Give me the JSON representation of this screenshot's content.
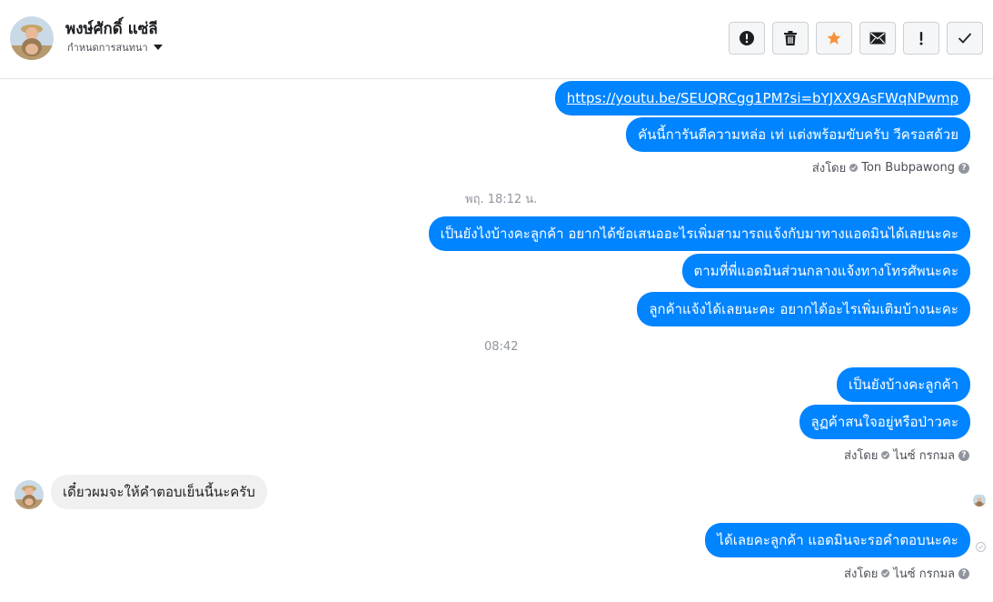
{
  "header": {
    "name": "พงษ์ศักดิ์ แซ่ลี",
    "assign_label": "กำหนดการสนทนา",
    "toolbar": [
      {
        "name": "report-spam-button",
        "icon": "alert-circle-icon"
      },
      {
        "name": "delete-button",
        "icon": "trash-icon"
      },
      {
        "name": "star-button",
        "icon": "star-icon",
        "color": "#f7923b"
      },
      {
        "name": "mark-unread-button",
        "icon": "envelope-icon"
      },
      {
        "name": "follow-up-button",
        "icon": "exclamation-icon"
      },
      {
        "name": "mark-done-button",
        "icon": "checkmark-icon"
      }
    ]
  },
  "conversation": {
    "messages": {
      "m1": "https://youtu.be/SEUQRCgg1PM?si=bYJXX9AsFWqNPwmp",
      "m2": "คันนี้การันตีความหล่อ เท่ แต่งพร้อมขับครับ วีครอสด้วย",
      "m3": "เป็นยังไงบ้างคะลูกค้า อยากได้ข้อเสนออะไรเพิ่มสามารถแจ้งกับมาทางแอดมินได้เลยนะคะ",
      "m4": "ตามที่พี่แอดมินส่วนกลางแจ้งทางโทรศัพนะคะ",
      "m5": "ลูกค้าแจ้งได้เลยนะคะ อยากได้อะไรเพิ่มเติมบ้างนะคะ",
      "m6": "เป็นยังบ้างคะลูกค้า",
      "m7": "ลูฏค้าสนใจอยู่หรือป่าวคะ",
      "m8": "เดี๋ยวผมจะให้คำตอบเย็นนี้นะครับ",
      "m9": "ได้เลยคะลูกค้า แอดมินจะรอคำตอบนะคะ"
    },
    "sent_by_1": {
      "label": "ส่งโดย",
      "agent": "Ton Bubpawong"
    },
    "sent_by_2": {
      "label": "ส่งโดย",
      "agent": "ไนซ์ กรกมล"
    },
    "sent_by_3": {
      "label": "ส่งโดย",
      "agent": "ไนซ์ กรกมล"
    },
    "timestamps": {
      "t1": "พฤ. 18:12 น.",
      "t2": "08:42"
    },
    "qmark": "?"
  },
  "colors": {
    "outgoing_bubble": "#0084ff",
    "incoming_bubble": "#f1f0f0",
    "star": "#f7923b"
  }
}
